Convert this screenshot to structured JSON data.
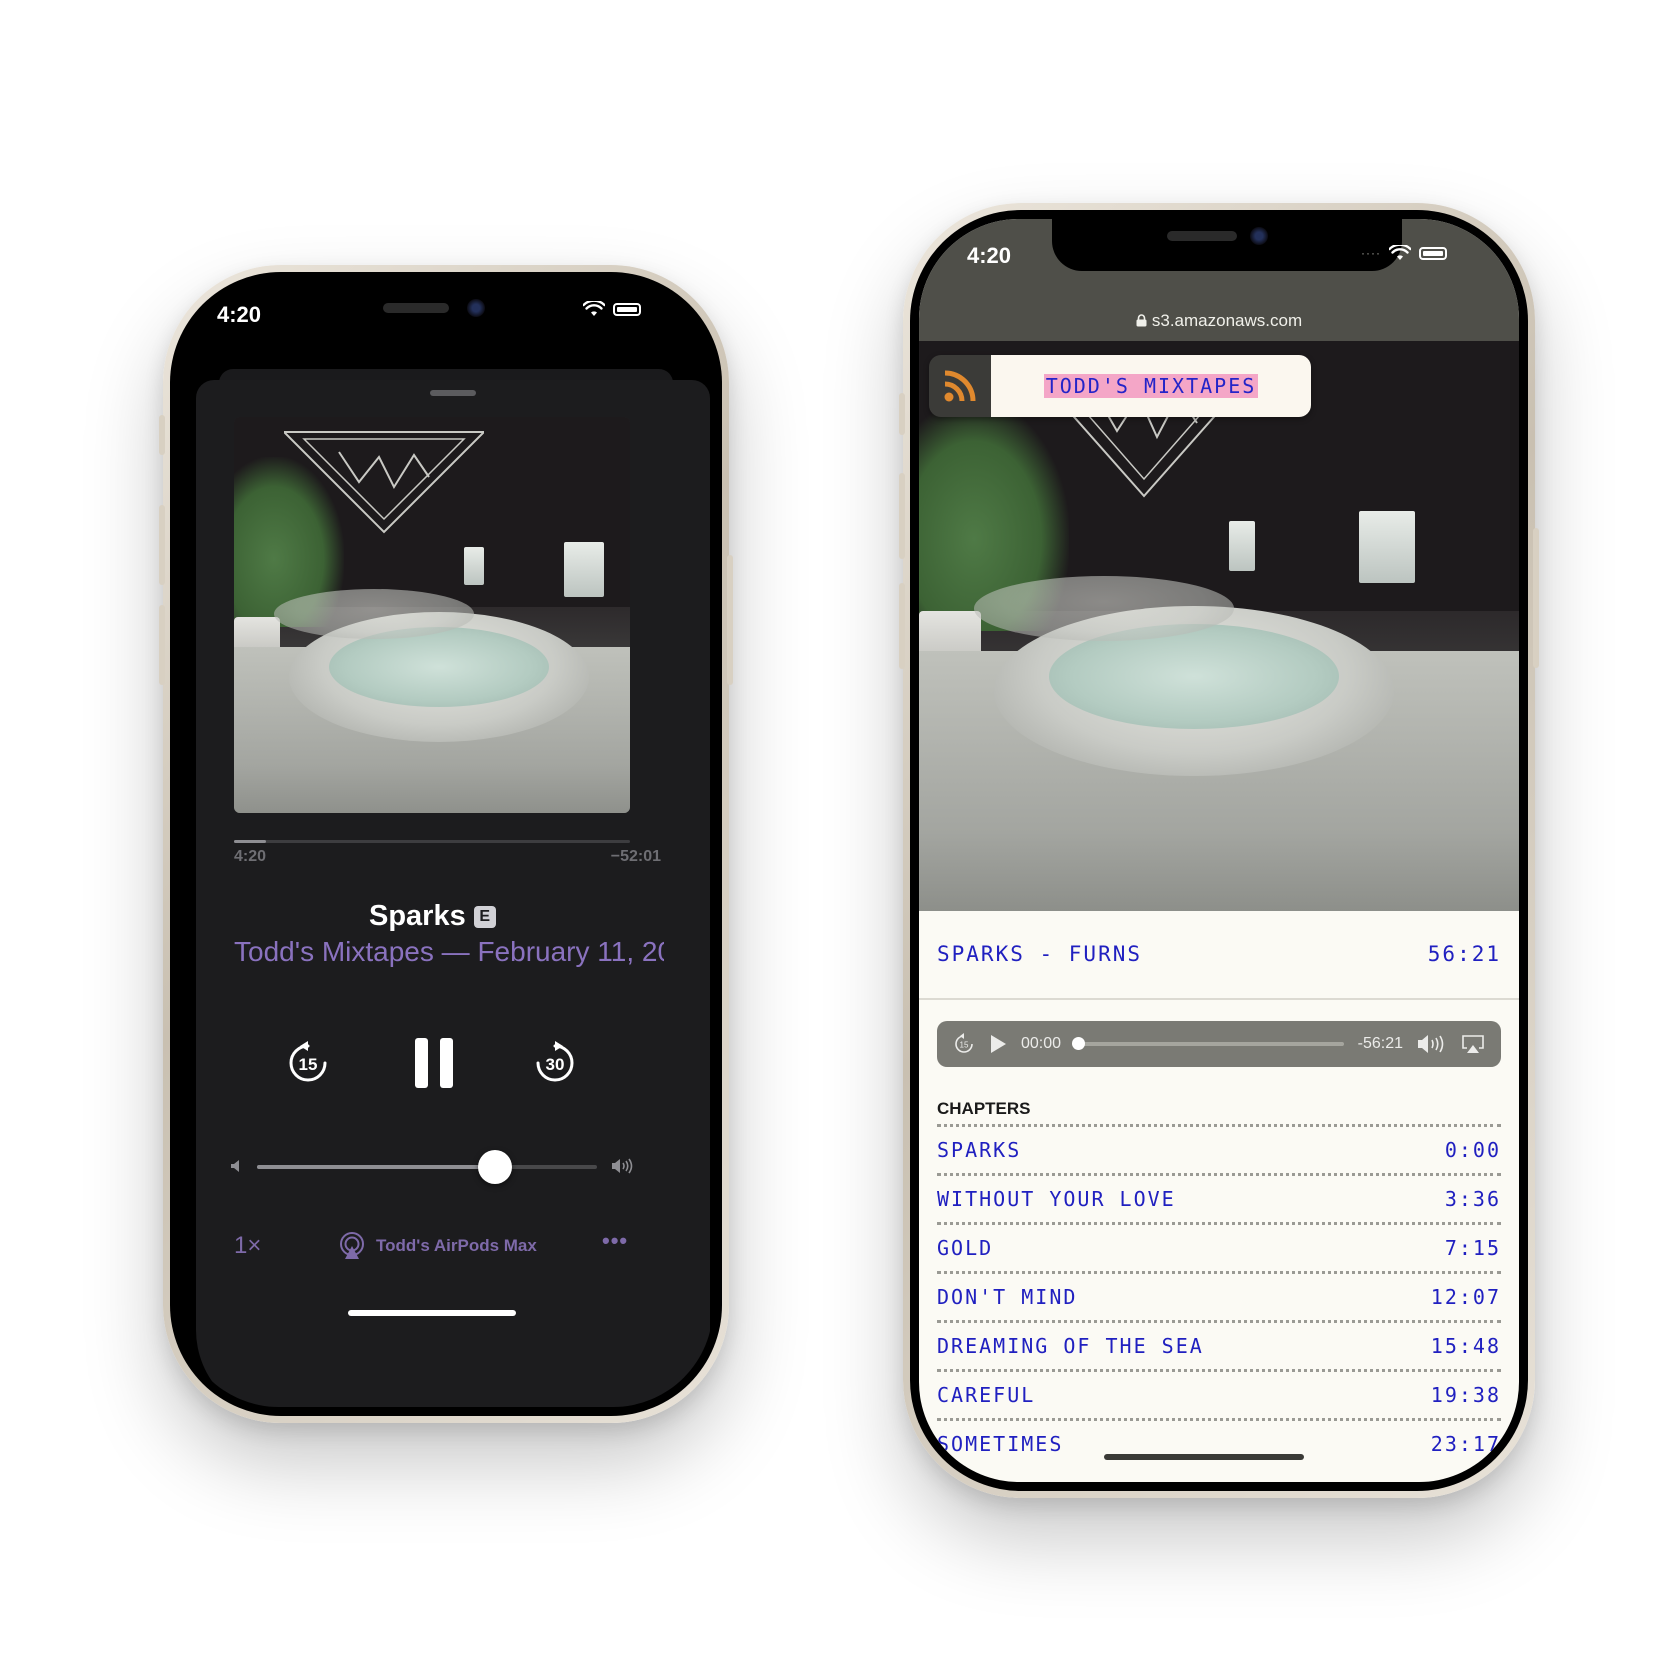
{
  "left_phone": {
    "status_time": "4:20",
    "progress": {
      "elapsed": "4:20",
      "remaining": "−52:01",
      "fraction": 0.08
    },
    "track": {
      "title": "Sparks",
      "explicit_badge": "E",
      "subtitle": "Todd's Mixtapes — February 11, 20"
    },
    "controls": {
      "skip_back_label": "15",
      "skip_forward_label": "30"
    },
    "volume": {
      "level": 0.7
    },
    "bottom": {
      "speed": "1×",
      "output_device": "Todd's AirPods Max",
      "more": "•••"
    },
    "accent_color": "#8a72bf"
  },
  "right_phone": {
    "status_time": "4:20",
    "url": "s3.amazonaws.com",
    "badge_title": "TODD'S MIXTAPES",
    "episode": {
      "title": "SPARKS - FURNS",
      "duration": "56:21"
    },
    "player": {
      "skip_label": "15",
      "current_time": "00:00",
      "remaining_time": "-56:21",
      "progress": 0.0
    },
    "chapters_heading": "CHAPTERS",
    "chapters": [
      {
        "title": "SPARKS",
        "time": "0:00"
      },
      {
        "title": "WITHOUT YOUR LOVE",
        "time": "3:36"
      },
      {
        "title": "GOLD",
        "time": "7:15"
      },
      {
        "title": "DON'T MIND",
        "time": "12:07"
      },
      {
        "title": "DREAMING OF THE SEA",
        "time": "15:48"
      },
      {
        "title": "CAREFUL",
        "time": "19:38"
      },
      {
        "title": "SOMETIMES",
        "time": "23:17"
      }
    ],
    "handwriting_color": "#2020c0",
    "highlight_color": "#f4a6c7"
  }
}
